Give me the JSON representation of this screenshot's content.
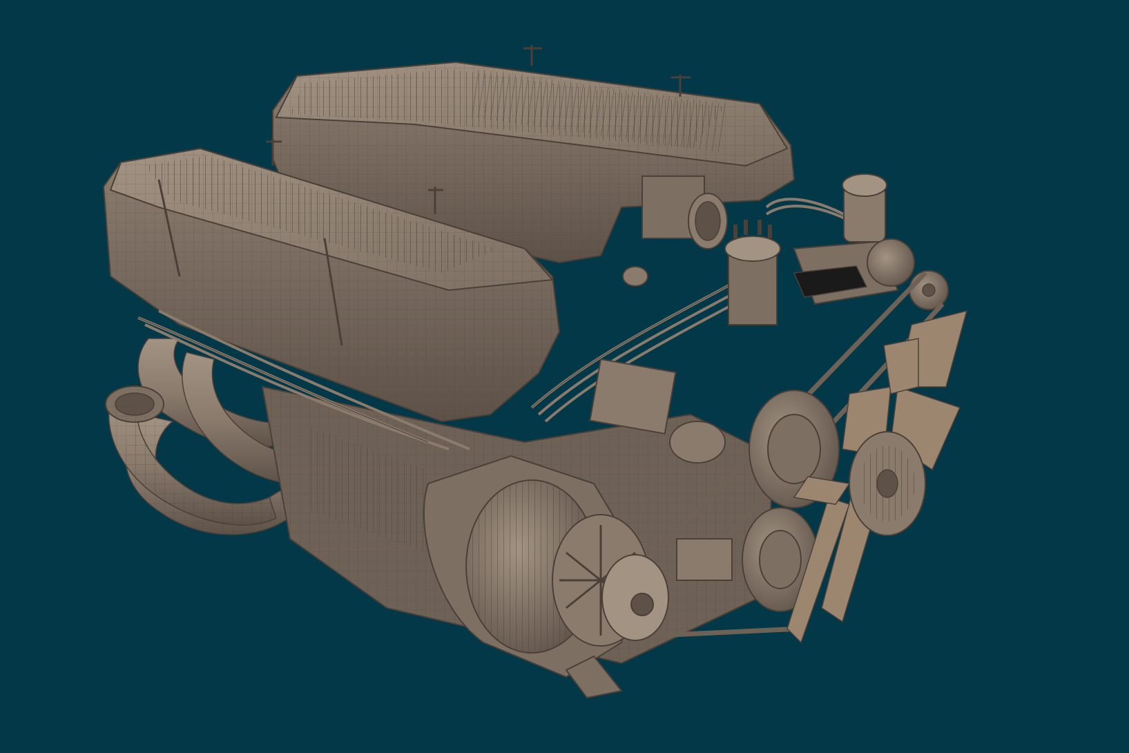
{
  "viewport": {
    "background_color": "#023848",
    "subject": "engine-wireframe-render"
  },
  "palette": {
    "body": "#8a7b6d",
    "body_light": "#a39383",
    "body_dark": "#5e5248",
    "shadow": "#463d36",
    "wire": "#4b4038",
    "black": "#1a1a1a",
    "fan_blade": "#9c8670"
  }
}
